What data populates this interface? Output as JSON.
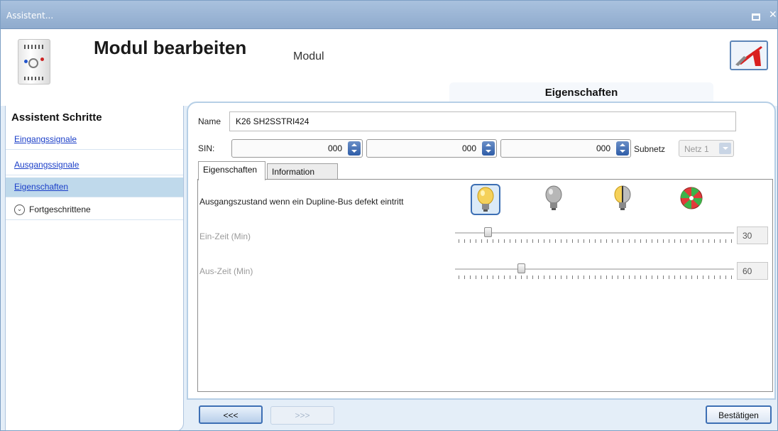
{
  "window": {
    "title": "Assistent..."
  },
  "header": {
    "title": "Modul bearbeiten",
    "subtitle": "Modul",
    "section_tab": "Eigenschaften"
  },
  "sidebar": {
    "title": "Assistent Schritte",
    "steps": [
      {
        "label": "Eingangssignale"
      },
      {
        "label": "Ausgangssignale"
      },
      {
        "label": "Eigenschaften"
      }
    ],
    "advanced": {
      "label": "Fortgeschrittene"
    }
  },
  "form": {
    "name_label": "Name",
    "name_value": "K26 SH2SSTRI424",
    "sin_label": "SIN:",
    "sin_values": [
      "000",
      "000",
      "000"
    ],
    "subnet_label": "Subnetz",
    "subnet_value": "Netz 1"
  },
  "tabs": [
    {
      "label": "Eigenschaften"
    },
    {
      "label": "Information"
    }
  ],
  "properties": {
    "output_state_label": "Ausgangszustand wenn ein Dupline-Bus defekt eintritt",
    "output_state_icons": [
      "bulb-on-icon",
      "bulb-off-icon",
      "bulb-half-icon",
      "toggle-wheel-icon"
    ],
    "on_time": {
      "label": "Ein-Zeit (Min)",
      "value": "30",
      "level_fraction": 0.12
    },
    "off_time": {
      "label": "Aus-Zeit (Min)",
      "value": "60",
      "level_fraction": 0.24
    }
  },
  "footer": {
    "prev_label": "<<<",
    "next_label": ">>>",
    "confirm_label": "Bestätigen"
  },
  "colors": {
    "link": "#1a3ec8",
    "accent": "#3d6fb4",
    "active_step": "#bfd9eb"
  }
}
